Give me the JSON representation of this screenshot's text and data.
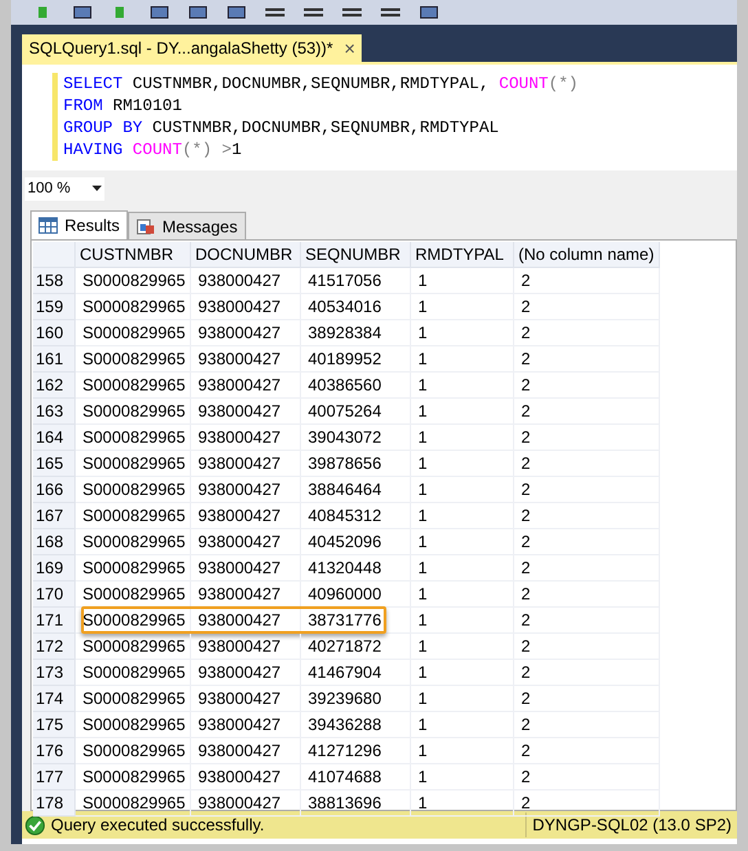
{
  "document_tab": {
    "title": "SQLQuery1.sql - DY...angalaShetty (53))*",
    "close": "×",
    "selected": true
  },
  "editor": {
    "lines": [
      [
        {
          "kind": "keyword",
          "text": "SELECT"
        },
        {
          "kind": "plain",
          "text": " CUSTNMBR,DOCNUMBR,SEQNUMBR,RMDTYPAL, "
        },
        {
          "kind": "function",
          "text": "COUNT"
        },
        {
          "kind": "operator",
          "text": "(*)"
        }
      ],
      [
        {
          "kind": "keyword",
          "text": "FROM"
        },
        {
          "kind": "plain",
          "text": " RM10101"
        }
      ],
      [
        {
          "kind": "keyword",
          "text": "GROUP BY"
        },
        {
          "kind": "plain",
          "text": " CUSTNMBR,DOCNUMBR,SEQNUMBR,RMDTYPAL"
        }
      ],
      [
        {
          "kind": "keyword",
          "text": "HAVING"
        },
        {
          "kind": "function",
          "text": " COUNT"
        },
        {
          "kind": "operator",
          "text": "(*) >"
        },
        {
          "kind": "plain",
          "text": "1"
        }
      ]
    ]
  },
  "zoom": {
    "value": "100 %"
  },
  "result_tabs": [
    {
      "label": "Results",
      "selected": true
    },
    {
      "label": "Messages",
      "selected": false
    }
  ],
  "table": {
    "columns": [
      "CUSTNMBR",
      "DOCNUMBR",
      "SEQNUMBR",
      "RMDTYPAL",
      "(No column name)"
    ],
    "rows": [
      {
        "num": "158",
        "cells": [
          "S0000829965",
          "938000427",
          "41517056",
          "1",
          "2"
        ],
        "highlighted": false
      },
      {
        "num": "159",
        "cells": [
          "S0000829965",
          "938000427",
          "40534016",
          "1",
          "2"
        ],
        "highlighted": false
      },
      {
        "num": "160",
        "cells": [
          "S0000829965",
          "938000427",
          "38928384",
          "1",
          "2"
        ],
        "highlighted": false
      },
      {
        "num": "161",
        "cells": [
          "S0000829965",
          "938000427",
          "40189952",
          "1",
          "2"
        ],
        "highlighted": false
      },
      {
        "num": "162",
        "cells": [
          "S0000829965",
          "938000427",
          "40386560",
          "1",
          "2"
        ],
        "highlighted": false
      },
      {
        "num": "163",
        "cells": [
          "S0000829965",
          "938000427",
          "40075264",
          "1",
          "2"
        ],
        "highlighted": false
      },
      {
        "num": "164",
        "cells": [
          "S0000829965",
          "938000427",
          "39043072",
          "1",
          "2"
        ],
        "highlighted": false
      },
      {
        "num": "165",
        "cells": [
          "S0000829965",
          "938000427",
          "39878656",
          "1",
          "2"
        ],
        "highlighted": false
      },
      {
        "num": "166",
        "cells": [
          "S0000829965",
          "938000427",
          "38846464",
          "1",
          "2"
        ],
        "highlighted": false
      },
      {
        "num": "167",
        "cells": [
          "S0000829965",
          "938000427",
          "40845312",
          "1",
          "2"
        ],
        "highlighted": false
      },
      {
        "num": "168",
        "cells": [
          "S0000829965",
          "938000427",
          "40452096",
          "1",
          "2"
        ],
        "highlighted": false
      },
      {
        "num": "169",
        "cells": [
          "S0000829965",
          "938000427",
          "41320448",
          "1",
          "2"
        ],
        "highlighted": false
      },
      {
        "num": "170",
        "cells": [
          "S0000829965",
          "938000427",
          "40960000",
          "1",
          "2"
        ],
        "highlighted": false
      },
      {
        "num": "171",
        "cells": [
          "S0000829965",
          "938000427",
          "38731776",
          "1",
          "2"
        ],
        "highlighted": true
      },
      {
        "num": "172",
        "cells": [
          "S0000829965",
          "938000427",
          "40271872",
          "1",
          "2"
        ],
        "highlighted": false
      },
      {
        "num": "173",
        "cells": [
          "S0000829965",
          "938000427",
          "41467904",
          "1",
          "2"
        ],
        "highlighted": false
      },
      {
        "num": "174",
        "cells": [
          "S0000829965",
          "938000427",
          "39239680",
          "1",
          "2"
        ],
        "highlighted": false
      },
      {
        "num": "175",
        "cells": [
          "S0000829965",
          "938000427",
          "39436288",
          "1",
          "2"
        ],
        "highlighted": false
      },
      {
        "num": "176",
        "cells": [
          "S0000829965",
          "938000427",
          "41271296",
          "1",
          "2"
        ],
        "highlighted": false
      },
      {
        "num": "177",
        "cells": [
          "S0000829965",
          "938000427",
          "41074688",
          "1",
          "2"
        ],
        "highlighted": false
      },
      {
        "num": "178",
        "cells": [
          "S0000829965",
          "938000427",
          "38813696",
          "1",
          "2"
        ],
        "highlighted": false
      }
    ]
  },
  "status_bar": {
    "message": "Query executed successfully.",
    "server": "DYNGP-SQL02 (13.0 SP2)"
  }
}
